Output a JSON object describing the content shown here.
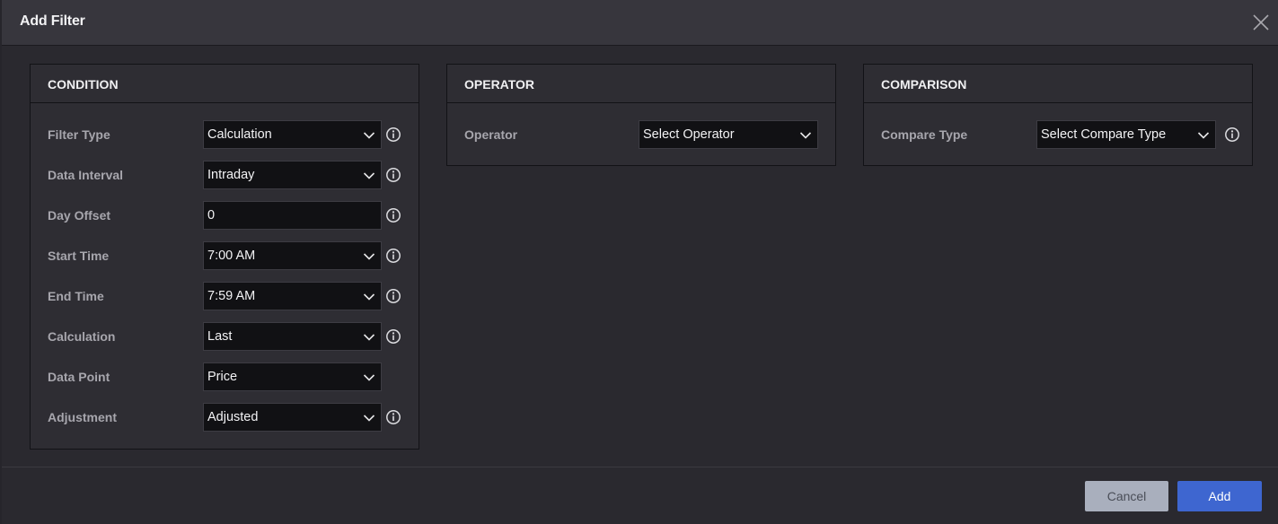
{
  "dialog": {
    "title": "Add Filter"
  },
  "condition": {
    "heading": "CONDITION",
    "rows": [
      {
        "label": "Filter Type",
        "value": "Calculation",
        "kind": "select",
        "info": true
      },
      {
        "label": "Data Interval",
        "value": "Intraday",
        "kind": "select",
        "info": true
      },
      {
        "label": "Day Offset",
        "value": "0",
        "kind": "input",
        "info": true
      },
      {
        "label": "Start Time",
        "value": "7:00 AM",
        "kind": "select",
        "info": true
      },
      {
        "label": "End Time",
        "value": "7:59 AM",
        "kind": "select",
        "info": true
      },
      {
        "label": "Calculation",
        "value": "Last",
        "kind": "select",
        "info": true
      },
      {
        "label": "Data Point",
        "value": "Price",
        "kind": "select",
        "info": false
      },
      {
        "label": "Adjustment",
        "value": "Adjusted",
        "kind": "select",
        "info": true
      }
    ]
  },
  "operator": {
    "heading": "OPERATOR",
    "label": "Operator",
    "value": "Select Operator"
  },
  "comparison": {
    "heading": "COMPARISON",
    "label": "Compare Type",
    "value": "Select Compare Type"
  },
  "footer": {
    "cancel_label": "Cancel",
    "add_label": "Add"
  },
  "icons": {
    "close": "close-icon",
    "chevron": "chevron-down-icon",
    "info": "info-icon"
  },
  "colors": {
    "accent": "#3e66d0",
    "cancel": "#a9afbd",
    "background": "#2a292f",
    "header": "#37363d"
  }
}
